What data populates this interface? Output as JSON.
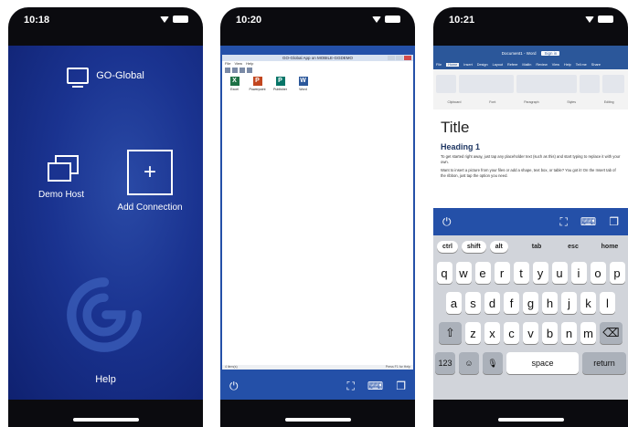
{
  "screens": [
    {
      "time": "10:18",
      "brand": "GO-Global",
      "demo_host": "Demo Host",
      "add_connection": "Add Connection",
      "help": "Help"
    },
    {
      "time": "10:20",
      "window_title": "GO-Global App on MOBILE-GGDEMO",
      "menu": [
        "File",
        "View",
        "Help"
      ],
      "apps": [
        {
          "name": "Excel",
          "color": "#1e7145",
          "letter": "X"
        },
        {
          "name": "Powerpoint",
          "color": "#c2461f",
          "letter": "P"
        },
        {
          "name": "Publisher",
          "color": "#077568",
          "letter": "P"
        },
        {
          "name": "Word",
          "color": "#2b579a",
          "letter": "W"
        }
      ],
      "status_left": "4 item(s)",
      "status_right": "Press F1 for Help"
    },
    {
      "time": "10:21",
      "doc_name": "Document1 - Word",
      "sign_in": "Sign in",
      "tabs": [
        "File",
        "Home",
        "Insert",
        "Design",
        "Layout",
        "Refere",
        "Mailin",
        "Review",
        "View",
        "Help",
        "Tell me",
        "Share"
      ],
      "ribbon_groups": [
        "Clipboard",
        "Font",
        "Paragraph",
        "Styles",
        "Editing"
      ],
      "doc_title": "Title",
      "heading": "Heading 1",
      "para1": "To get started right away, just tap any placeholder text (such as this) and start typing to replace it with your own.",
      "para2": "Want to insert a picture from your files or add a shape, text box, or table? You got it! On the Insert tab of the ribbon, just tap the option you need.",
      "mod_keys": [
        "ctrl",
        "shift",
        "alt"
      ],
      "func_keys": [
        "tab",
        "esc",
        "home"
      ],
      "row1": [
        "q",
        "w",
        "e",
        "r",
        "t",
        "y",
        "u",
        "i",
        "o",
        "p"
      ],
      "row2": [
        "a",
        "s",
        "d",
        "f",
        "g",
        "h",
        "j",
        "k",
        "l"
      ],
      "row3": [
        "z",
        "x",
        "c",
        "v",
        "b",
        "n",
        "m"
      ],
      "num_key": "123",
      "space_key": "space",
      "return_key": "return"
    }
  ]
}
